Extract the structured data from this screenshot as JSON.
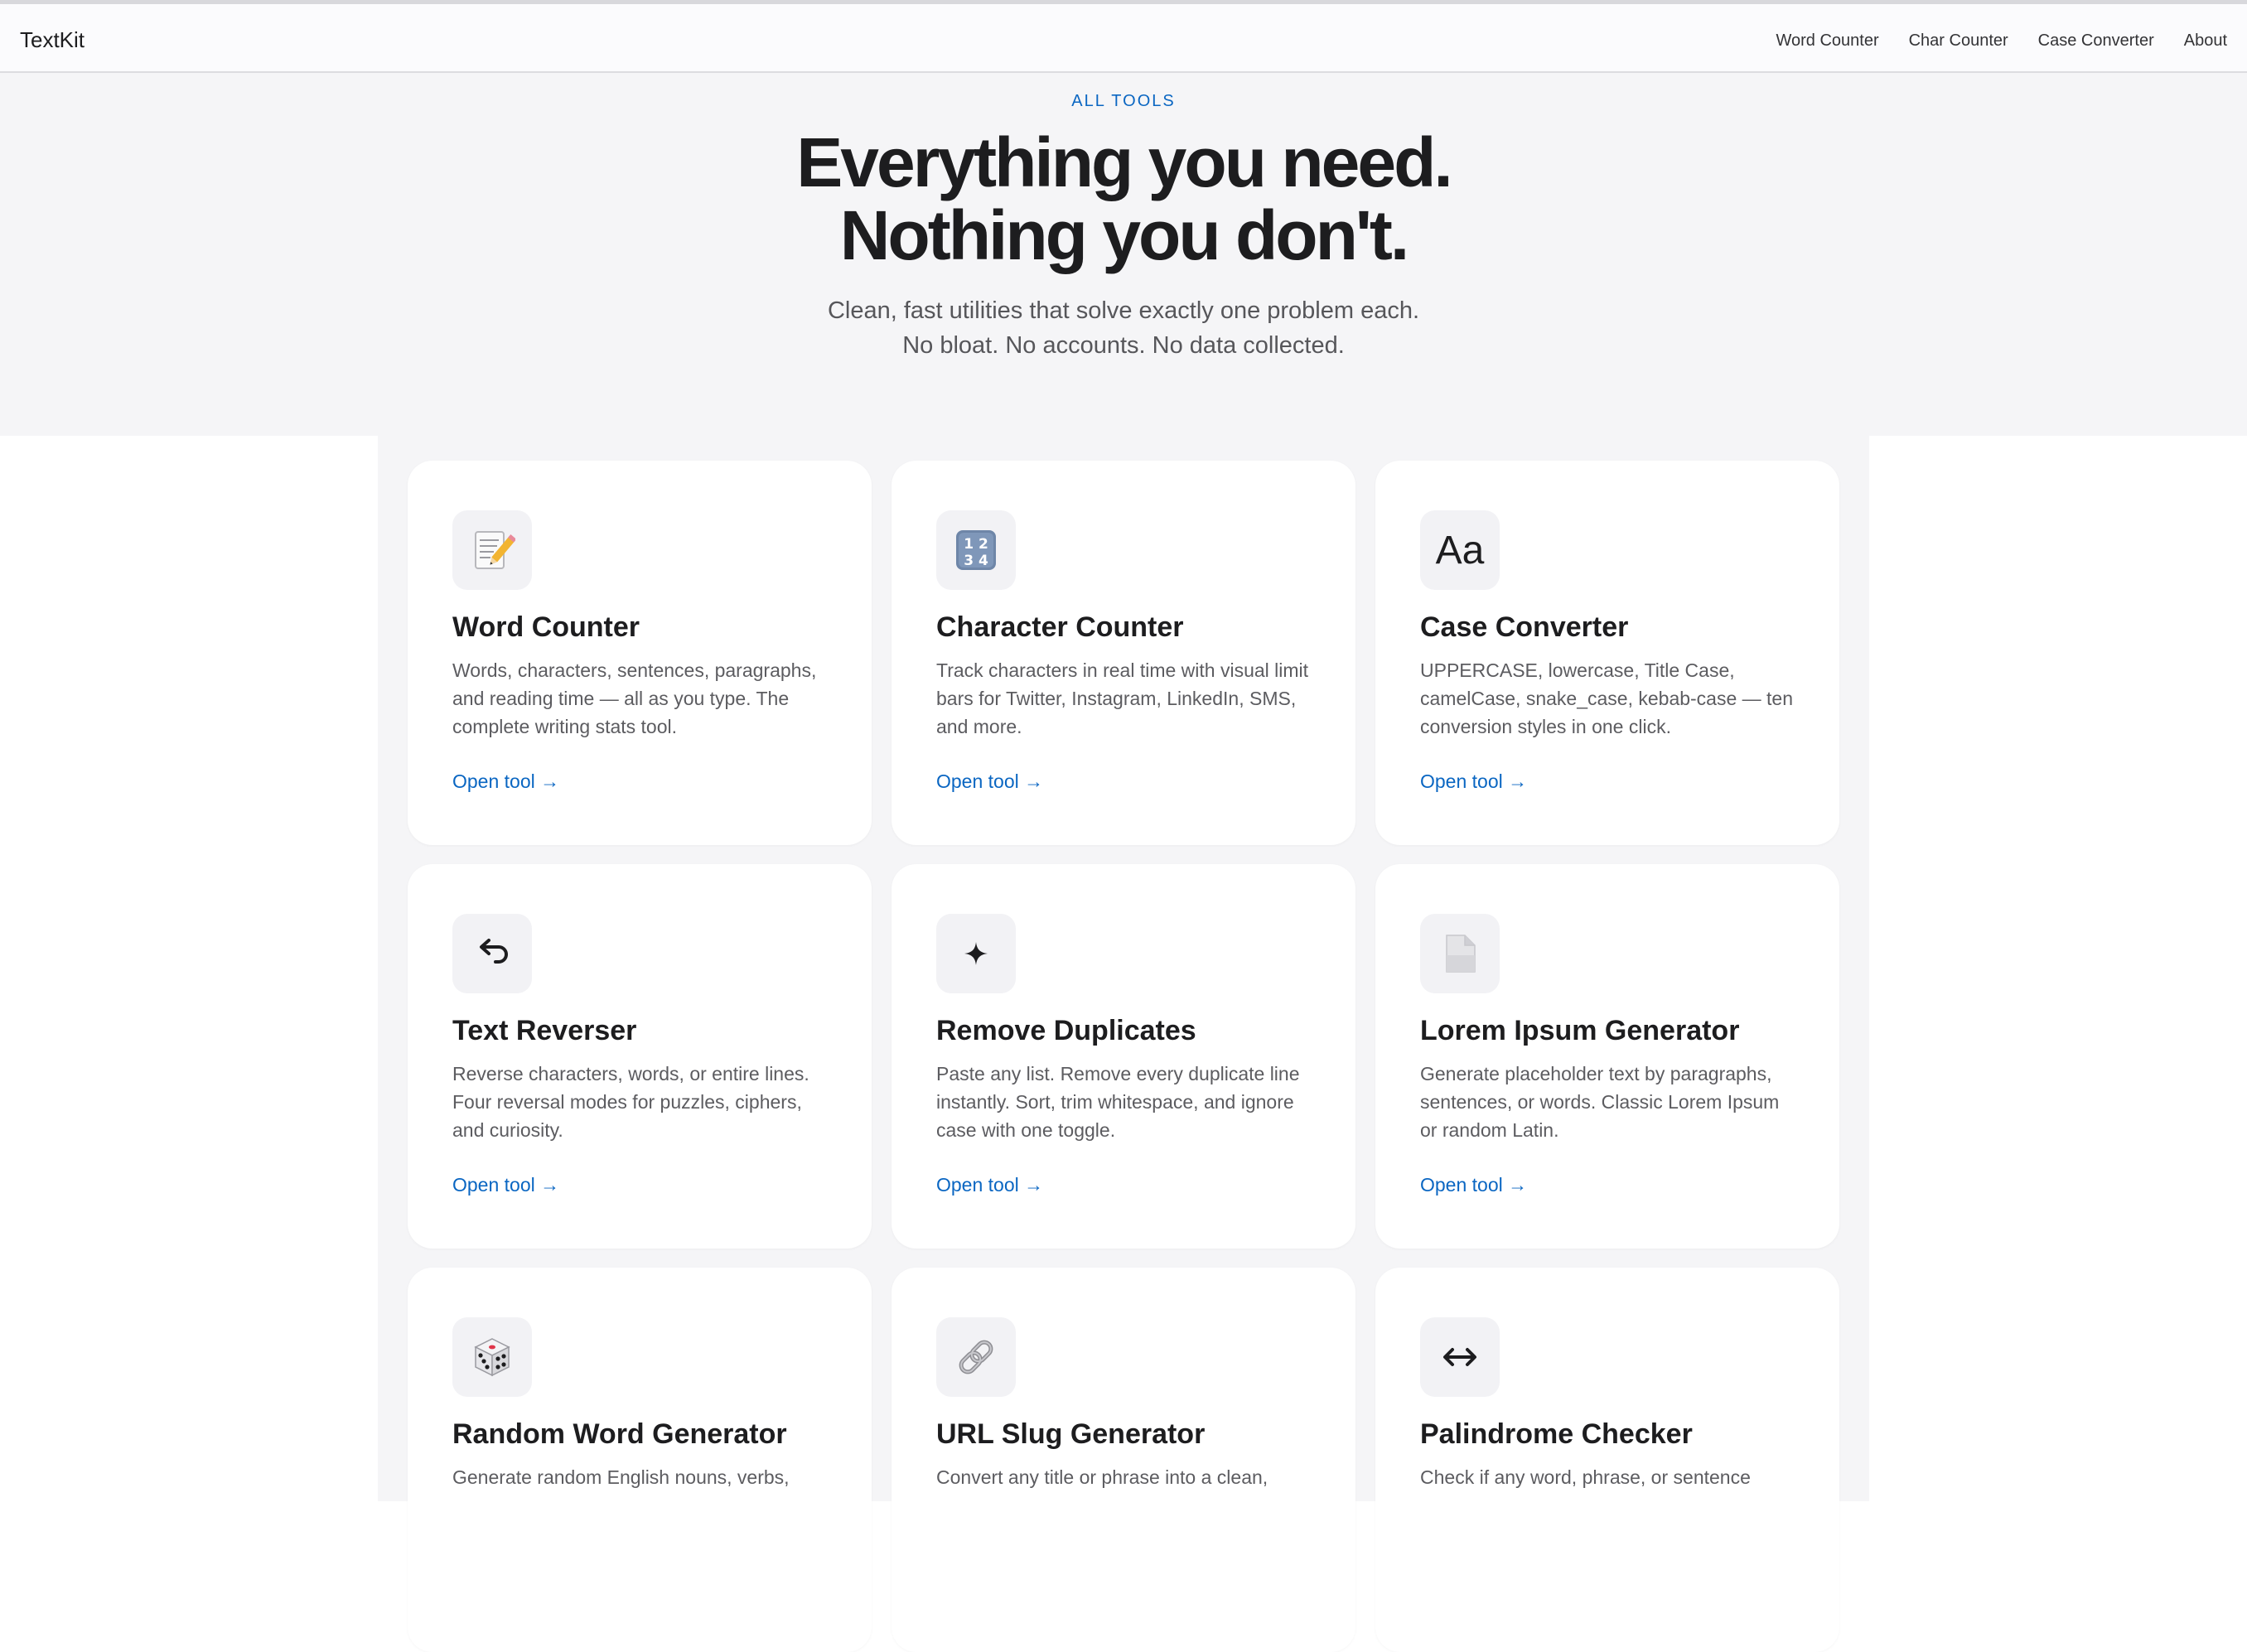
{
  "navbar": {
    "brand": "TextKit",
    "links": [
      "Word Counter",
      "Char Counter",
      "Case Converter",
      "About"
    ]
  },
  "hero": {
    "eyebrow": "ALL TOOLS",
    "headline_line1": "Everything you need.",
    "headline_line2": "Nothing you don't.",
    "subline_line1": "Clean, fast utilities that solve exactly one problem each.",
    "subline_line2": "No bloat. No accounts. No data collected."
  },
  "tools": [
    {
      "icon": "memo-pencil-icon",
      "title": "Word Counter",
      "description": "Words, characters, sentences, paragraphs, and reading time — all as you type. The complete writing stats tool.",
      "link": "Open tool →"
    },
    {
      "icon": "number-keycap-icon",
      "title": "Character Counter",
      "description": "Track characters in real time with visual limit bars for Twitter, Instagram, LinkedIn, SMS, and more.",
      "link": "Open tool →"
    },
    {
      "icon": "letter-case-icon",
      "icon_text": "Aa",
      "title": "Case Converter",
      "description": "UPPERCASE, lowercase, Title Case, camelCase, snake_case, kebab-case — ten conversion styles in one click.",
      "link": "Open tool →"
    },
    {
      "icon": "return-arrow-icon",
      "title": "Text Reverser",
      "description": "Reverse characters, words, or entire lines. Four reversal modes for puzzles, ciphers, and curiosity.",
      "link": "Open tool →"
    },
    {
      "icon": "sparkle-icon",
      "title": "Remove Duplicates",
      "description": "Paste any list. Remove every duplicate line instantly. Sort, trim whitespace, and ignore case with one toggle.",
      "link": "Open tool →"
    },
    {
      "icon": "document-icon",
      "title": "Lorem Ipsum Generator",
      "description": "Generate placeholder text by paragraphs, sentences, or words. Classic Lorem Ipsum or random Latin.",
      "link": "Open tool →"
    },
    {
      "icon": "dice-icon",
      "title": "Random Word Generator",
      "description": "Generate random English nouns, verbs,",
      "link": ""
    },
    {
      "icon": "chain-link-icon",
      "title": "URL Slug Generator",
      "description": "Convert any title or phrase into a clean,",
      "link": ""
    },
    {
      "icon": "left-right-arrow-icon",
      "title": "Palindrome Checker",
      "description": "Check if any word, phrase, or sentence",
      "link": ""
    }
  ],
  "colors": {
    "accent": "#0a66c2",
    "heading": "#1d1d1f",
    "body_text": "#5c5c60",
    "page_gray": "#f5f5f7"
  }
}
